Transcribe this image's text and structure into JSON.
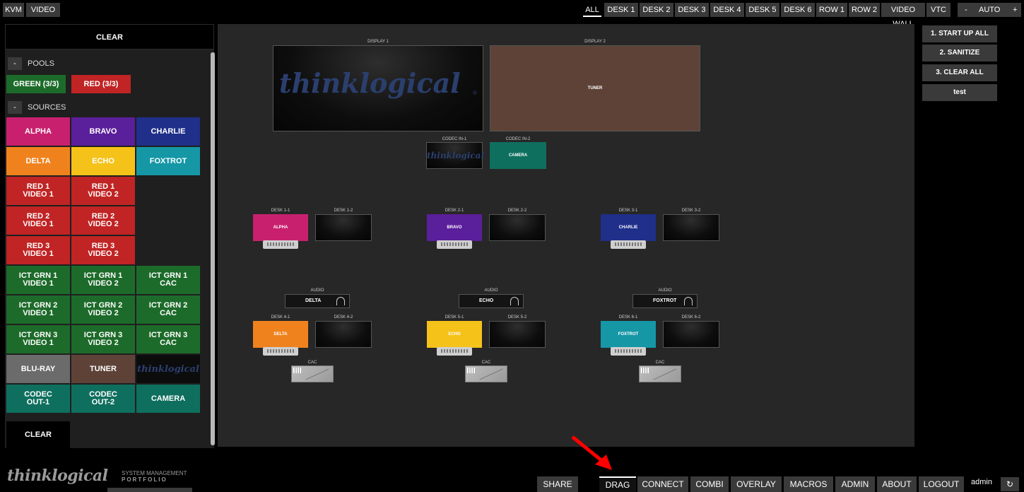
{
  "topbar": {
    "left_tabs": [
      "KVM",
      "VIDEO"
    ],
    "right_tabs": [
      "ALL",
      "DESK 1",
      "DESK 2",
      "DESK 3",
      "DESK 4",
      "DESK 5",
      "DESK 6",
      "ROW 1",
      "ROW 2",
      "VIDEO WALL",
      "VTC"
    ],
    "active_tab": "ALL",
    "auto_minus": "-",
    "auto_label": "AUTO",
    "auto_plus": "+"
  },
  "sidebar": {
    "clear_top": "CLEAR",
    "pools_header": "POOLS",
    "pools_minus": "-",
    "pools": [
      {
        "label": "GREEN (3/3)",
        "color": "#1d6b2a"
      },
      {
        "label": "RED (3/3)",
        "color": "#c02424"
      }
    ],
    "sources_header": "SOURCES",
    "sources_minus": "-",
    "sources": [
      {
        "label": "ALPHA",
        "color": "#c8206e"
      },
      {
        "label": "BRAVO",
        "color": "#5a1f9a"
      },
      {
        "label": "CHARLIE",
        "color": "#1f2f8a"
      },
      {
        "label": "DELTA",
        "color": "#f0821e"
      },
      {
        "label": "ECHO",
        "color": "#f5c21a"
      },
      {
        "label": "FOXTROT",
        "color": "#1597a6"
      },
      {
        "label": "RED 1\nVIDEO 1",
        "color": "#c02424"
      },
      {
        "label": "RED 1\nVIDEO 2",
        "color": "#c02424"
      },
      {
        "label": "RED 2\nVIDEO 1",
        "color": "#c02424"
      },
      {
        "label": "RED 2\nVIDEO 2",
        "color": "#c02424"
      },
      {
        "label": "RED 3\nVIDEO 1",
        "color": "#c02424"
      },
      {
        "label": "RED 3\nVIDEO 2",
        "color": "#c02424"
      },
      {
        "label": "ICT GRN 1\nVIDEO 1",
        "color": "#1d6b2a"
      },
      {
        "label": "ICT GRN 1\nVIDEO 2",
        "color": "#1d6b2a"
      },
      {
        "label": "ICT GRN 1\nCAC",
        "color": "#1d6b2a"
      },
      {
        "label": "ICT GRN 2\nVIDEO 1",
        "color": "#1d6b2a"
      },
      {
        "label": "ICT GRN 2\nVIDEO 2",
        "color": "#1d6b2a"
      },
      {
        "label": "ICT GRN 2\nCAC",
        "color": "#1d6b2a"
      },
      {
        "label": "ICT GRN 3\nVIDEO 1",
        "color": "#1d6b2a"
      },
      {
        "label": "ICT GRN 3\nVIDEO 2",
        "color": "#1d6b2a"
      },
      {
        "label": "ICT GRN 3\nCAC",
        "color": "#1d6b2a"
      },
      {
        "label": "BLU-RAY",
        "color": "#6b6b6b"
      },
      {
        "label": "TUNER",
        "color": "#5e4238"
      },
      {
        "label": "thinklogical",
        "color": "#0c0c0c",
        "logo": true
      },
      {
        "label": "CODEC\nOUT-1",
        "color": "#0f6f5e"
      },
      {
        "label": "CODEC\nOUT-2",
        "color": "#0f6f5e"
      },
      {
        "label": "CAMERA",
        "color": "#0f6f5e"
      }
    ],
    "clear_bottom": "CLEAR"
  },
  "canvas": {
    "display1": {
      "label": "DISPLAY 1",
      "logo": "thinklogical",
      "logo_mark": "®"
    },
    "display2": {
      "label": "DISPLAY 2",
      "content": "TUNER",
      "color": "#5e4238"
    },
    "codec_in1": {
      "label": "CODEC IN-1",
      "logo": "thinklogical"
    },
    "codec_in2": {
      "label": "CODEC IN-2",
      "content": "CAMERA",
      "color": "#0f6f5e"
    },
    "desks_row1": [
      {
        "label1": "DESK 1-1",
        "label2": "DESK 1-2",
        "content": "ALPHA",
        "color": "#c8206e"
      },
      {
        "label1": "DESK 2-1",
        "label2": "DESK 2-2",
        "content": "BRAVO",
        "color": "#5a1f9a"
      },
      {
        "label1": "DESK 3-1",
        "label2": "DESK 3-2",
        "content": "CHARLIE",
        "color": "#1f2f8a"
      }
    ],
    "audio": [
      {
        "label": "AUDIO",
        "content": "DELTA"
      },
      {
        "label": "AUDIO",
        "content": "ECHO"
      },
      {
        "label": "AUDIO",
        "content": "FOXTROT"
      }
    ],
    "desks_row2": [
      {
        "label1": "DESK 4-1",
        "label2": "DESK 4-2",
        "content": "DELTA",
        "color": "#f0821e"
      },
      {
        "label1": "DESK 5-1",
        "label2": "DESK 5-2",
        "content": "ECHO",
        "color": "#f5c21a"
      },
      {
        "label1": "DESK 6-1",
        "label2": "DESK 6-2",
        "content": "FOXTROT",
        "color": "#1597a6"
      }
    ],
    "cac_label": "CAC"
  },
  "macros": [
    "1. START UP ALL",
    "2. SANITIZE",
    "3. CLEAR ALL",
    "test"
  ],
  "bottombar": {
    "brand": "thinklogical",
    "brand_sub1": "SYSTEM MANAGEMENT",
    "brand_sub2": "PORTFOLIO",
    "buttons": [
      "SHARE",
      "DRAG",
      "CONNECT",
      "COMBI",
      "OVERLAY",
      "MACROS",
      "ADMIN",
      "ABOUT",
      "LOGOUT"
    ],
    "active_button": "DRAG",
    "user": "admin",
    "refresh_icon": "↻"
  },
  "annotation": {
    "arrow_color": "#ff0000"
  }
}
